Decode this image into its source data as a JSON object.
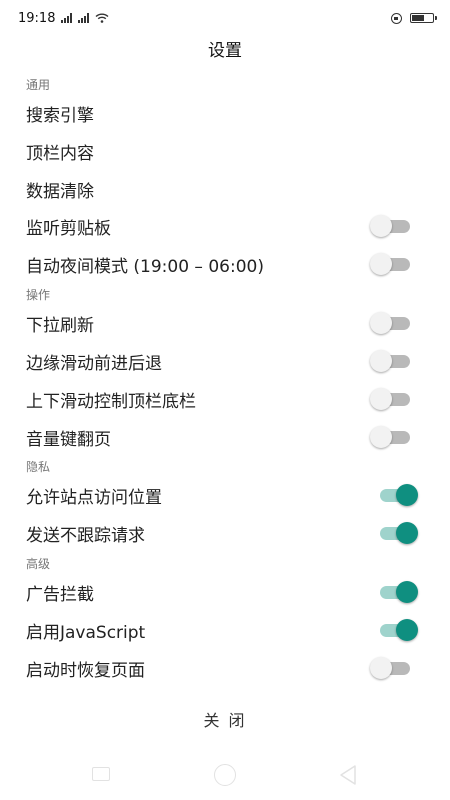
{
  "status_bar": {
    "time": "19:18",
    "network_icon": "signal-bars-icon",
    "wifi_icon": "wifi-icon",
    "battery_icon": "battery-icon"
  },
  "dialog": {
    "title": "设置",
    "close_label": "关 闭"
  },
  "sections": {
    "general": {
      "header": "通用",
      "items": {
        "search_engine": "搜索引擎",
        "toolbar_content": "顶栏内容",
        "clear_data": "数据清除",
        "clipboard": "监听剪贴板",
        "night_mode": "自动夜间模式 (19:00 – 06:00)"
      }
    },
    "operation": {
      "header": "操作",
      "items": {
        "pull_refresh": "下拉刷新",
        "edge_swipe": "边缘滑动前进后退",
        "swipe_bars": "上下滑动控制顶栏底栏",
        "volume_keys": "音量键翻页"
      }
    },
    "privacy": {
      "header": "隐私",
      "items": {
        "location": "允许站点访问位置",
        "dnt": "发送不跟踪请求"
      }
    },
    "advanced": {
      "header": "高级",
      "items": {
        "adblock": "广告拦截",
        "javascript": "启用JavaScript",
        "restore": "启动时恢复页面"
      }
    }
  },
  "toggles": {
    "clipboard": false,
    "night_mode": false,
    "pull_refresh": false,
    "edge_swipe": false,
    "swipe_bars": false,
    "volume_keys": false,
    "location": true,
    "dnt": true,
    "adblock": true,
    "javascript": true,
    "restore": false
  },
  "colors": {
    "accent": "#0f8f80",
    "accent_track": "#9fd3cc",
    "off_track": "#b9b9b9"
  }
}
